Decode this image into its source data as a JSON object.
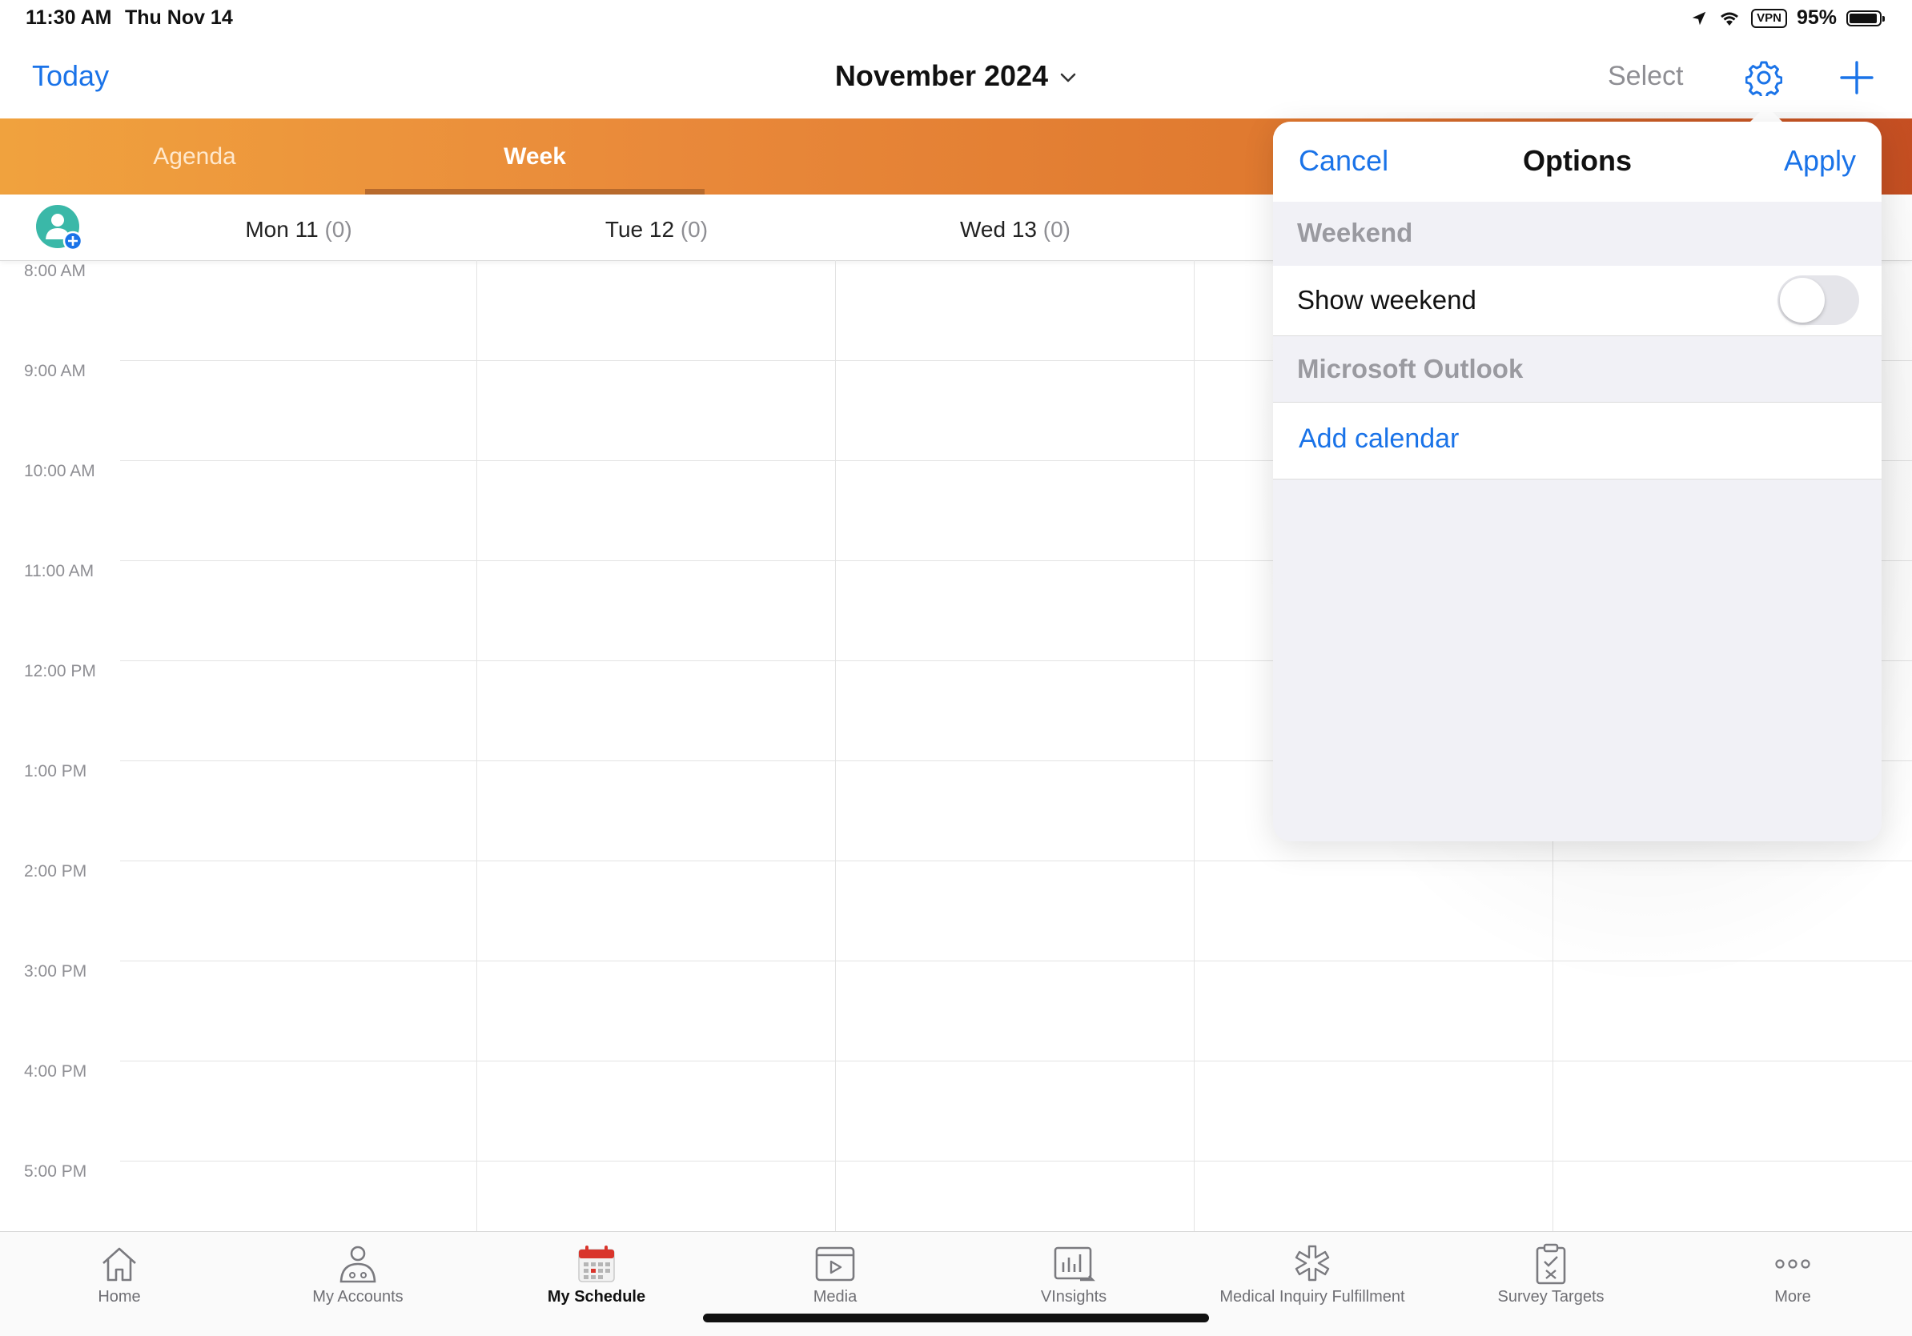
{
  "status_bar": {
    "time": "11:30 AM",
    "date": "Thu Nov 14",
    "vpn": "VPN",
    "battery": "95%",
    "battery_level": 0.95,
    "icons": [
      "location-arrow-icon",
      "wifi-icon",
      "vpn-icon",
      "battery-icon"
    ]
  },
  "nav": {
    "today": "Today",
    "title": "November 2024",
    "select": "Select",
    "gear_icon": "gear-icon",
    "add_icon": "plus-icon"
  },
  "segments": {
    "agenda": "Agenda",
    "week": "Week",
    "selected": "Week"
  },
  "day_header": {
    "avatar_icon": "add-attendee-icon",
    "days": [
      {
        "label": "Mon 11",
        "count": "(0)"
      },
      {
        "label": "Tue 12",
        "count": "(0)"
      },
      {
        "label": "Wed 13",
        "count": "(0)"
      }
    ]
  },
  "time_slots": [
    "8:00 AM",
    "9:00 AM",
    "10:00 AM",
    "11:00 AM",
    "12:00 PM",
    "1:00 PM",
    "2:00 PM",
    "3:00 PM",
    "4:00 PM",
    "5:00 PM"
  ],
  "options_popover": {
    "cancel": "Cancel",
    "title": "Options",
    "apply": "Apply",
    "weekend_section": "Weekend",
    "show_weekend_label": "Show weekend",
    "show_weekend_on": false,
    "outlook_section": "Microsoft Outlook",
    "add_calendar": "Add calendar"
  },
  "tab_bar": {
    "items": [
      {
        "label": "Home",
        "icon": "home-icon"
      },
      {
        "label": "My Accounts",
        "icon": "accounts-icon"
      },
      {
        "label": "My Schedule",
        "icon": "calendar-icon",
        "active": true
      },
      {
        "label": "Media",
        "icon": "media-icon"
      },
      {
        "label": "VInsights",
        "icon": "insights-icon"
      },
      {
        "label": "Medical Inquiry Fulfillment",
        "icon": "medical-star-icon"
      },
      {
        "label": "Survey Targets",
        "icon": "survey-clipboard-icon"
      },
      {
        "label": "More",
        "icon": "more-dots-icon"
      }
    ]
  },
  "colors": {
    "accent_blue": "#1a73e8",
    "orange_start": "#f0a23e",
    "orange_end": "#c64f22",
    "calendar_red": "#d9342b"
  }
}
